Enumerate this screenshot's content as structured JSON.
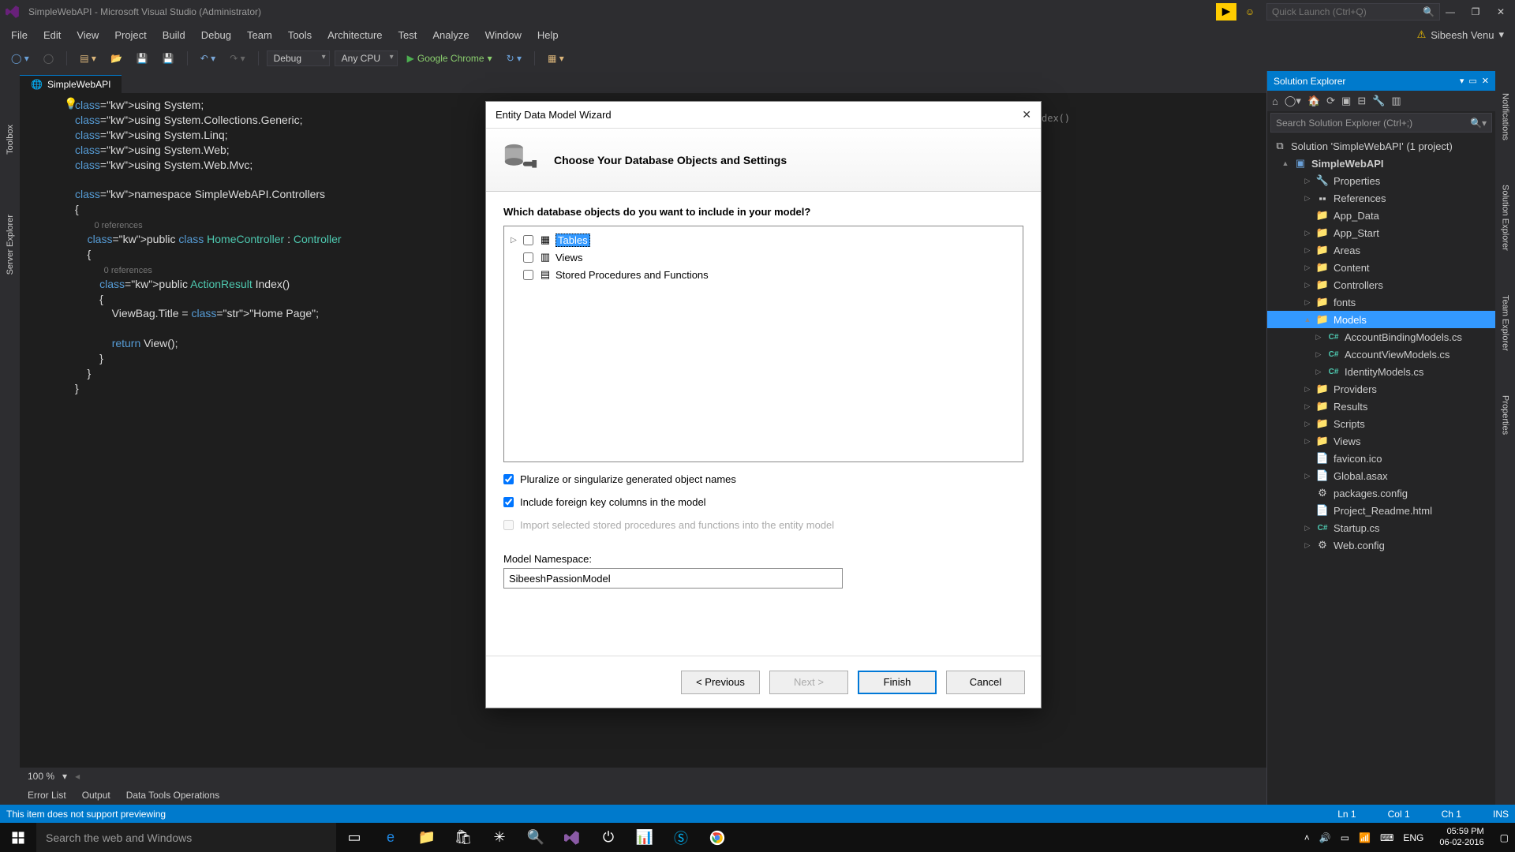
{
  "titlebar": {
    "title": "SimpleWebAPI - Microsoft Visual Studio (Administrator)",
    "quicklaunch_placeholder": "Quick Launch (Ctrl+Q)"
  },
  "menubar": {
    "items": [
      "File",
      "Edit",
      "View",
      "Project",
      "Build",
      "Debug",
      "Team",
      "Tools",
      "Architecture",
      "Test",
      "Analyze",
      "Window",
      "Help"
    ],
    "user": "Sibeesh Venu"
  },
  "toolbar": {
    "config": "Debug",
    "platform": "Any CPU",
    "start_label": "Google Chrome"
  },
  "left_tabs": [
    "Toolbox",
    "Server Explorer"
  ],
  "right_tabs": [
    "Notifications",
    "Solution Explorer",
    "Team Explorer",
    "Properties"
  ],
  "document": {
    "tab_name": "SimpleWebAPI",
    "behind_text": "dex()",
    "code_lines": [
      "using System;",
      "using System.Collections.Generic;",
      "using System.Linq;",
      "using System.Web;",
      "using System.Web.Mvc;",
      "",
      "namespace SimpleWebAPI.Controllers",
      "{",
      "    0 references",
      "    public class HomeController : Controller",
      "    {",
      "        0 references",
      "        public ActionResult Index()",
      "        {",
      "            ViewBag.Title = \"Home Page\";",
      "",
      "            return View();",
      "        }",
      "    }",
      "}"
    ],
    "zoom": "100 %"
  },
  "wizard": {
    "title": "Entity Data Model Wizard",
    "subtitle": "Choose Your Database Objects and Settings",
    "question": "Which database objects do you want to include in your model?",
    "objects": [
      "Tables",
      "Views",
      "Stored Procedures and Functions"
    ],
    "opt_pluralize": "Pluralize or singularize generated object names",
    "opt_fk": "Include foreign key columns in the model",
    "opt_import": "Import selected stored procedures and functions into the entity model",
    "ns_label": "Model Namespace:",
    "ns_value": "SibeeshPassionModel",
    "btn_prev": "< Previous",
    "btn_next": "Next >",
    "btn_finish": "Finish",
    "btn_cancel": "Cancel"
  },
  "solution": {
    "header": "Solution Explorer",
    "search_placeholder": "Search Solution Explorer (Ctrl+;)",
    "root": "Solution 'SimpleWebAPI' (1 project)",
    "project": "SimpleWebAPI",
    "nodes": [
      {
        "label": "Properties",
        "kind": "wrench",
        "indent": 2,
        "arrow": "▷"
      },
      {
        "label": "References",
        "kind": "ref",
        "indent": 2,
        "arrow": "▷"
      },
      {
        "label": "App_Data",
        "kind": "folder",
        "indent": 2,
        "arrow": ""
      },
      {
        "label": "App_Start",
        "kind": "folder",
        "indent": 2,
        "arrow": "▷"
      },
      {
        "label": "Areas",
        "kind": "folder",
        "indent": 2,
        "arrow": "▷"
      },
      {
        "label": "Content",
        "kind": "folder",
        "indent": 2,
        "arrow": "▷"
      },
      {
        "label": "Controllers",
        "kind": "folder",
        "indent": 2,
        "arrow": "▷"
      },
      {
        "label": "fonts",
        "kind": "folder",
        "indent": 2,
        "arrow": "▷"
      },
      {
        "label": "Models",
        "kind": "folder",
        "indent": 2,
        "arrow": "▲",
        "selected": true
      },
      {
        "label": "AccountBindingModels.cs",
        "kind": "cs",
        "indent": 3,
        "arrow": "▷"
      },
      {
        "label": "AccountViewModels.cs",
        "kind": "cs",
        "indent": 3,
        "arrow": "▷"
      },
      {
        "label": "IdentityModels.cs",
        "kind": "cs",
        "indent": 3,
        "arrow": "▷"
      },
      {
        "label": "Providers",
        "kind": "folder",
        "indent": 2,
        "arrow": "▷"
      },
      {
        "label": "Results",
        "kind": "folder",
        "indent": 2,
        "arrow": "▷"
      },
      {
        "label": "Scripts",
        "kind": "folder",
        "indent": 2,
        "arrow": "▷"
      },
      {
        "label": "Views",
        "kind": "folder",
        "indent": 2,
        "arrow": "▷"
      },
      {
        "label": "favicon.ico",
        "kind": "file",
        "indent": 2,
        "arrow": ""
      },
      {
        "label": "Global.asax",
        "kind": "file",
        "indent": 2,
        "arrow": "▷"
      },
      {
        "label": "packages.config",
        "kind": "config",
        "indent": 2,
        "arrow": ""
      },
      {
        "label": "Project_Readme.html",
        "kind": "file",
        "indent": 2,
        "arrow": ""
      },
      {
        "label": "Startup.cs",
        "kind": "cs",
        "indent": 2,
        "arrow": "▷"
      },
      {
        "label": "Web.config",
        "kind": "config",
        "indent": 2,
        "arrow": "▷"
      }
    ]
  },
  "bottom_tabs": [
    "Error List",
    "Output",
    "Data Tools Operations"
  ],
  "statusbar": {
    "message": "This item does not support previewing",
    "ln": "Ln 1",
    "col": "Col 1",
    "ch": "Ch 1",
    "ins": "INS"
  },
  "taskbar": {
    "search_placeholder": "Search the web and Windows",
    "lang": "ENG",
    "time": "05:59 PM",
    "date": "06-02-2016"
  }
}
